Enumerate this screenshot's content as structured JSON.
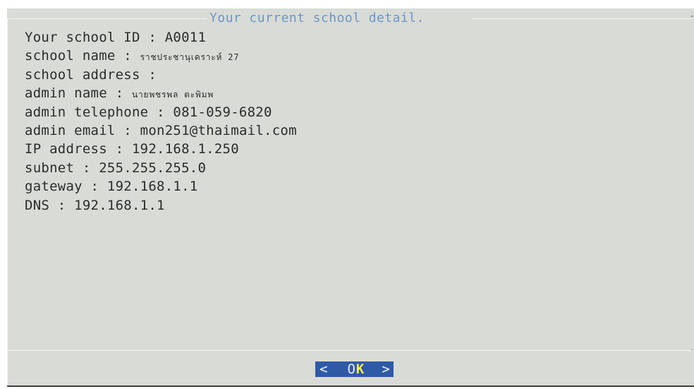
{
  "dialog": {
    "title": "Your current school detail.",
    "fields": [
      {
        "label": "Your school ID",
        "sep": " : ",
        "value": "A0011"
      },
      {
        "label": "school name",
        "sep": " : ",
        "value": "ราชประชานุเคราะห์ 27"
      },
      {
        "label": "school address",
        "sep": " :",
        "value": ""
      },
      {
        "label": "admin name",
        "sep": " : ",
        "value": "นายพชรพล ตะพิมพ"
      },
      {
        "label": "admin telephone",
        "sep": " : ",
        "value": "081-059-6820"
      },
      {
        "label": "admin email",
        "sep": " : ",
        "value": "mon251@thaimail.com"
      },
      {
        "label": "IP address",
        "sep": " : ",
        "value": "192.168.1.250"
      },
      {
        "label": "subnet",
        "sep": " : ",
        "value": "255.255.255.0"
      },
      {
        "label": "gateway",
        "sep": " : ",
        "value": "192.168.1.1"
      },
      {
        "label": "DNS",
        "sep": " : ",
        "value": "192.168.1.1"
      }
    ],
    "button": {
      "left_bracket": "<",
      "label_first": "O",
      "label_hotkey": "K",
      "right_bracket": ">"
    }
  },
  "colors": {
    "background": "#d9dcd6",
    "title": "#6d94c7",
    "text": "#2b2c2a",
    "button_bg": "#2e5aa6",
    "hotkey": "#f4ef5a"
  }
}
